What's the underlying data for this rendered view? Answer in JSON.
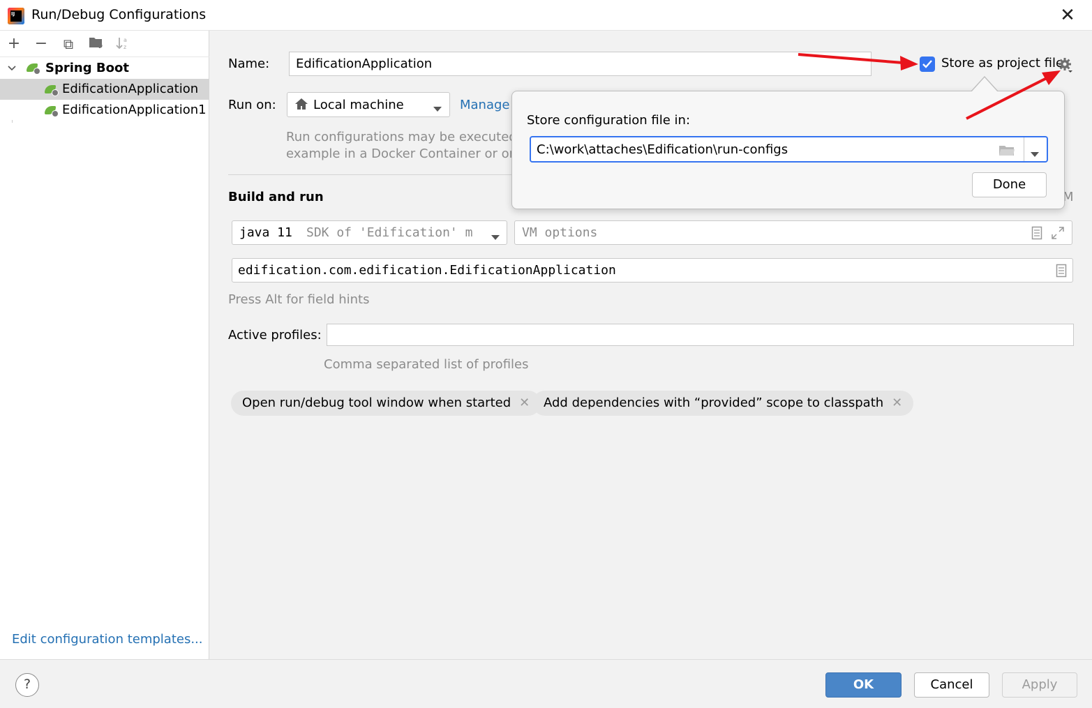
{
  "window": {
    "title": "Run/Debug Configurations",
    "close_glyph": "✕"
  },
  "toolbar": {
    "add": "+",
    "remove": "−",
    "copy": "⧉",
    "folder": "▇",
    "sort": "↓"
  },
  "tree": {
    "group": "Spring Boot",
    "items": [
      "EdificationApplication",
      "EdificationApplication1"
    ]
  },
  "left_footer": {
    "edit_templates": "Edit configuration templates..."
  },
  "form": {
    "name_label": "Name:",
    "name_value": "EdificationApplication",
    "store_label": "Store as project file",
    "run_on_label": "Run on:",
    "run_on_value": "Local machine",
    "manage_link": "Manage",
    "run_on_hint_1": "Run configurations may be executed lo",
    "run_on_hint_2": "example in a Docker Container or on a",
    "build_and_run": "Build and run",
    "modify_clipped": "M",
    "jre_version": "java 11",
    "jre_detail": "SDK of 'Edification' m",
    "vm_options_placeholder": "VM options",
    "main_class": "edification.com.edification.EdificationApplication",
    "alt_hint": "Press Alt for field hints",
    "active_profiles_label": "Active profiles:",
    "active_profiles_value": "",
    "profiles_hint": "Comma separated list of profiles",
    "chips": [
      "Open run/debug tool window when started",
      "Add dependencies with “provided” scope to classpath"
    ]
  },
  "popup": {
    "label": "Store configuration file in:",
    "path": "C:\\work\\attaches\\Edification\\run-configs",
    "done": "Done"
  },
  "buttons": {
    "help": "?",
    "ok": "OK",
    "cancel": "Cancel",
    "apply": "Apply"
  },
  "colors": {
    "accent": "#3574f0",
    "ok_button": "#4a86c8",
    "link": "#2470b3",
    "spring_green": "#6db33f",
    "annotation_arrow": "#e8141b"
  }
}
